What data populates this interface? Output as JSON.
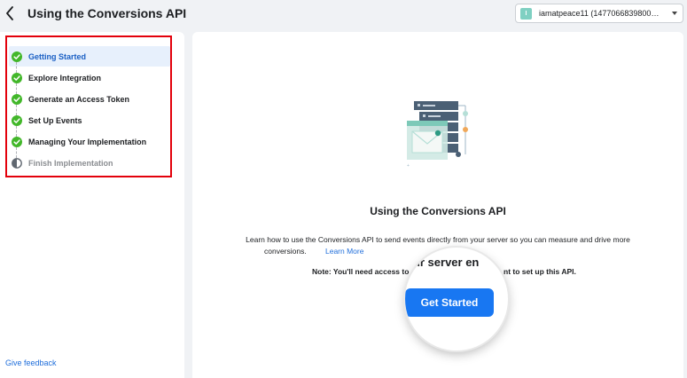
{
  "header": {
    "title": "Using the Conversions API",
    "account": {
      "badge": "I",
      "label": "iamatpeace11 (1477066839800…"
    }
  },
  "sidebar": {
    "steps": [
      {
        "label": "Getting Started",
        "status": "complete",
        "active": true
      },
      {
        "label": "Explore Integration",
        "status": "complete"
      },
      {
        "label": "Generate an Access Token",
        "status": "complete"
      },
      {
        "label": "Set Up Events",
        "status": "complete"
      },
      {
        "label": "Managing Your Implementation",
        "status": "complete"
      },
      {
        "label": "Finish Implementation",
        "status": "pending"
      }
    ],
    "feedback": "Give feedback"
  },
  "main": {
    "title": "Using the Conversions API",
    "description_line1": "Learn how to use the Conversions API to send events directly from your server so you can measure and drive more",
    "description_line2": "conversions.",
    "learn_more": "Learn More",
    "note_start": "Note: You'll need access to",
    "note_end": "nt to set up this API.",
    "magnified_text": "our server en",
    "cta": "Get Started"
  },
  "colors": {
    "accent": "#1877f2",
    "complete": "#42b72a",
    "highlight_border": "#e3000b",
    "link": "#216fdb"
  }
}
